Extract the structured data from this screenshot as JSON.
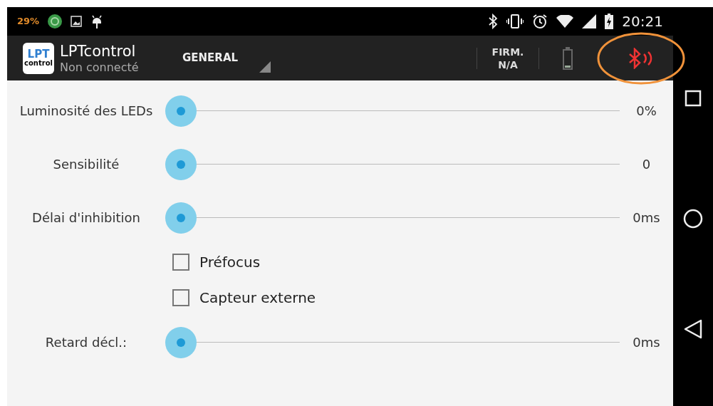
{
  "status_bar": {
    "battery_percent": "29%",
    "time": "20:21"
  },
  "action_bar": {
    "logo": {
      "top": "LPT",
      "bottom": "control"
    },
    "title": "LPTcontrol",
    "subtitle": "Non connecté",
    "section": "GENERAL",
    "firmware": {
      "label": "FIRM.",
      "value": "N/A"
    },
    "bluetooth_connected": false
  },
  "settings": [
    {
      "kind": "slider",
      "label": "Luminosité des LEDs",
      "reading": "0%"
    },
    {
      "kind": "slider",
      "label": "Sensibilité",
      "reading": "0"
    },
    {
      "kind": "slider",
      "label": "Délai d'inhibition",
      "reading": "0ms"
    },
    {
      "kind": "checkbox",
      "label": "Préfocus",
      "checked": false
    },
    {
      "kind": "checkbox",
      "label": "Capteur externe",
      "checked": false
    },
    {
      "kind": "slider",
      "label": "Retard décl.:",
      "reading": "0ms"
    }
  ]
}
